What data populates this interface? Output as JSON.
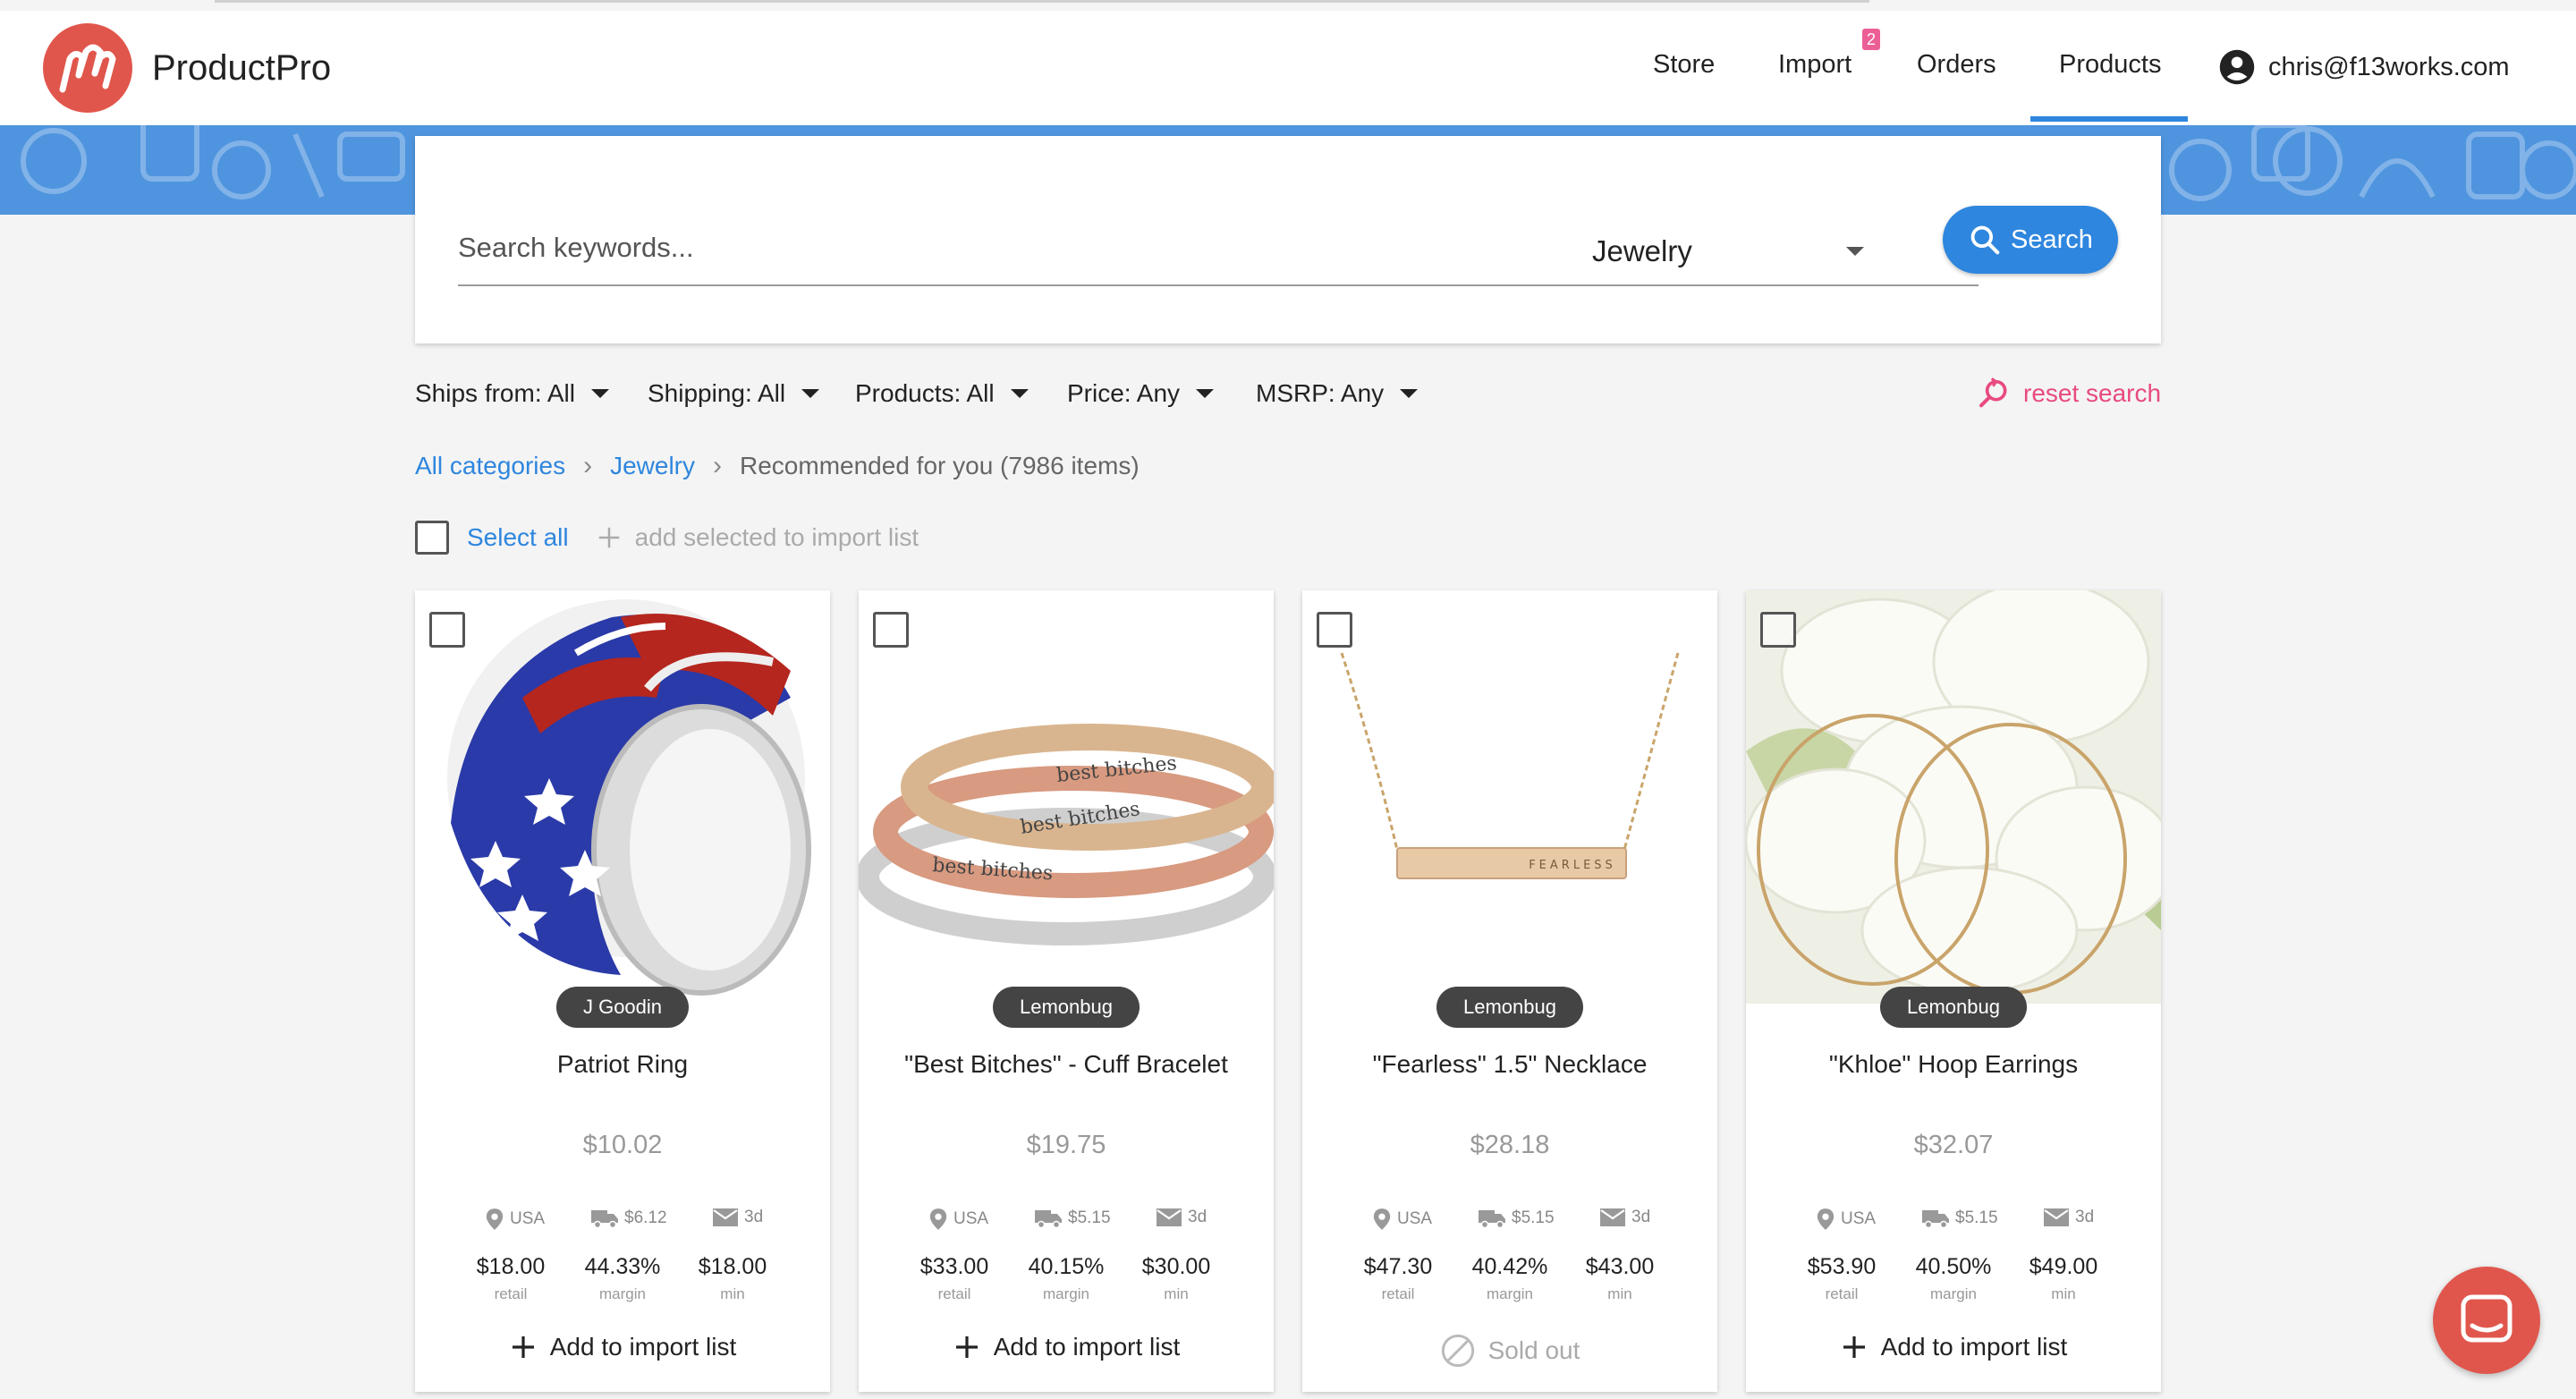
{
  "header": {
    "brand": "ProductPro",
    "nav": {
      "store": "Store",
      "import": "Import",
      "import_badge": "2",
      "orders": "Orders",
      "products": "Products"
    },
    "user_email": "chris@f13works.com"
  },
  "search": {
    "placeholder": "Search keywords...",
    "value": "",
    "category": "Jewelry",
    "button_label": "Search"
  },
  "filters": {
    "ships_from": "Ships from: All",
    "shipping": "Shipping: All",
    "products": "Products: All",
    "price": "Price: Any",
    "msrp": "MSRP: Any",
    "reset": "reset search"
  },
  "breadcrumb": {
    "all": "All categories",
    "category": "Jewelry",
    "current": "Recommended for you (7986 items)"
  },
  "selection": {
    "select_all": "Select all",
    "add_selected": "add selected to import list"
  },
  "products": [
    {
      "brand": "J Goodin",
      "title": "Patriot Ring",
      "price": "$10.02",
      "origin": "USA",
      "ship_cost": "$6.12",
      "ship_time": "3d",
      "retail": "$18.00",
      "retail_label": "retail",
      "margin": "44.33%",
      "margin_label": "margin",
      "min": "$18.00",
      "min_label": "min",
      "action": "Add to import list"
    },
    {
      "brand": "Lemonbug",
      "title": "\"Best Bitches\" - Cuff Bracelet",
      "price": "$19.75",
      "origin": "USA",
      "ship_cost": "$5.15",
      "ship_time": "3d",
      "retail": "$33.00",
      "retail_label": "retail",
      "margin": "40.15%",
      "margin_label": "margin",
      "min": "$30.00",
      "min_label": "min",
      "action": "Add to import list"
    },
    {
      "brand": "Lemonbug",
      "title": "\"Fearless\" 1.5\" Necklace",
      "price": "$28.18",
      "origin": "USA",
      "ship_cost": "$5.15",
      "ship_time": "3d",
      "retail": "$47.30",
      "retail_label": "retail",
      "margin": "40.42%",
      "margin_label": "margin",
      "min": "$43.00",
      "min_label": "min",
      "action": "Sold out",
      "image_text": "FEARLESS"
    },
    {
      "brand": "Lemonbug",
      "title": "\"Khloe\" Hoop Earrings",
      "price": "$32.07",
      "origin": "USA",
      "ship_cost": "$5.15",
      "ship_time": "3d",
      "retail": "$53.90",
      "retail_label": "retail",
      "margin": "40.50%",
      "margin_label": "margin",
      "min": "$49.00",
      "min_label": "min",
      "action": "Add to import list"
    }
  ],
  "bracelet_engravings": [
    "best bitches",
    "best bitches",
    "best bitches"
  ],
  "colors": {
    "accent": "#2e86de",
    "logo": "#e0564c",
    "badge": "#ec5f96",
    "reset": "#e84a7f",
    "banner": "#4f94de"
  }
}
